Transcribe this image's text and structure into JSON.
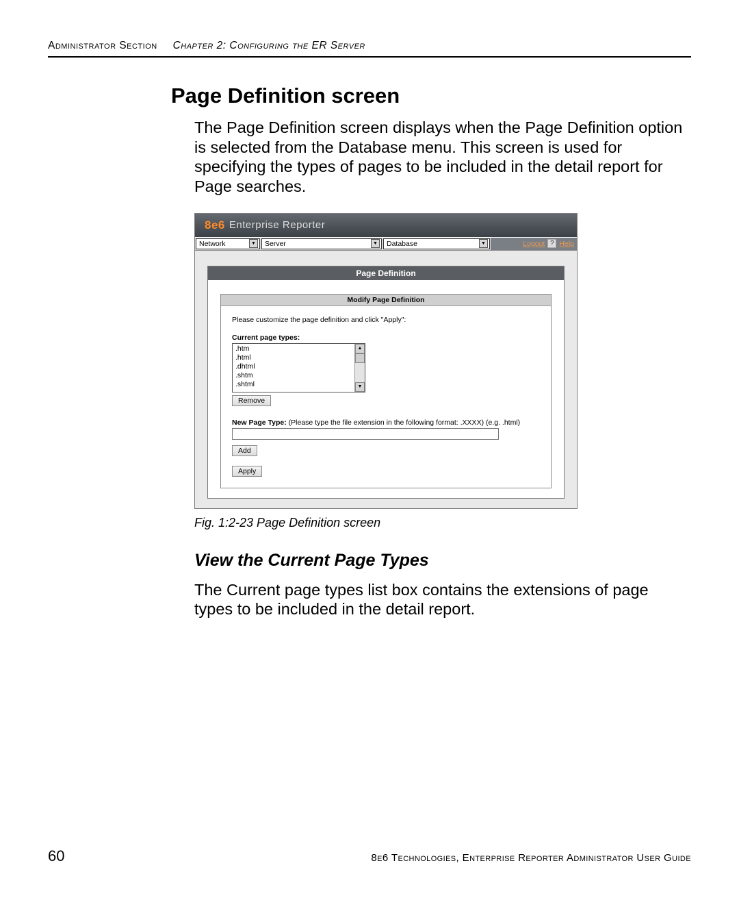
{
  "header": {
    "section": "Administrator Section",
    "chapter": "Chapter 2: Configuring the ER Server"
  },
  "title": "Page Definition screen",
  "intro_paragraph": "The Page Definition screen displays when the Page Definition option is selected from the Database menu. This screen is used for specifying the types of pages to be included in the detail report for Page searches.",
  "app": {
    "brand_prefix": "8e6",
    "brand_suffix": "Enterprise Reporter",
    "menus": {
      "network": "Network",
      "server": "Server",
      "database": "Database"
    },
    "links": {
      "logout": "Logout",
      "help": "Help",
      "help_icon": "?"
    },
    "panel_title": "Page Definition",
    "sub_title": "Modify Page Definition",
    "instruction": "Please customize the page definition and click \"Apply\":",
    "current_label": "Current page types:",
    "page_types": [
      ".htm",
      ".html",
      ".dhtml",
      ".shtm",
      ".shtml"
    ],
    "buttons": {
      "remove": "Remove",
      "add": "Add",
      "apply": "Apply"
    },
    "new_type_label": "New Page Type:",
    "new_type_hint": " (Please type the file extension in the following format: .XXXX) (e.g. .html)",
    "new_type_value": ""
  },
  "figure_caption": "Fig. 1:2-23  Page Definition screen",
  "subheading": "View the Current Page Types",
  "sub_paragraph": "The Current page types list box contains the extensions of page types to be included in the detail report.",
  "footer": {
    "page_number": "60",
    "text": "8e6 Technologies, Enterprise Reporter Administrator User Guide"
  }
}
